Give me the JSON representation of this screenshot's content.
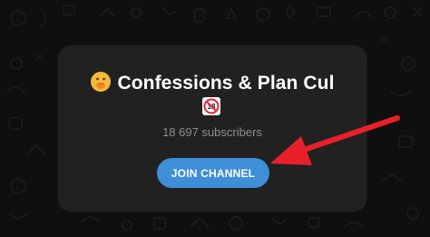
{
  "channel": {
    "title": "Confessions & Plan Cul",
    "title_emoji": "face-with-hand-over-mouth",
    "age_badge": "18",
    "subscribers": "18 697 subscribers"
  },
  "actions": {
    "join_label": "JOIN CHANNEL"
  },
  "colors": {
    "background": "#0f0f0f",
    "card": "#212121",
    "button": "#3e8ed8",
    "annotation_arrow": "#e8202a"
  }
}
